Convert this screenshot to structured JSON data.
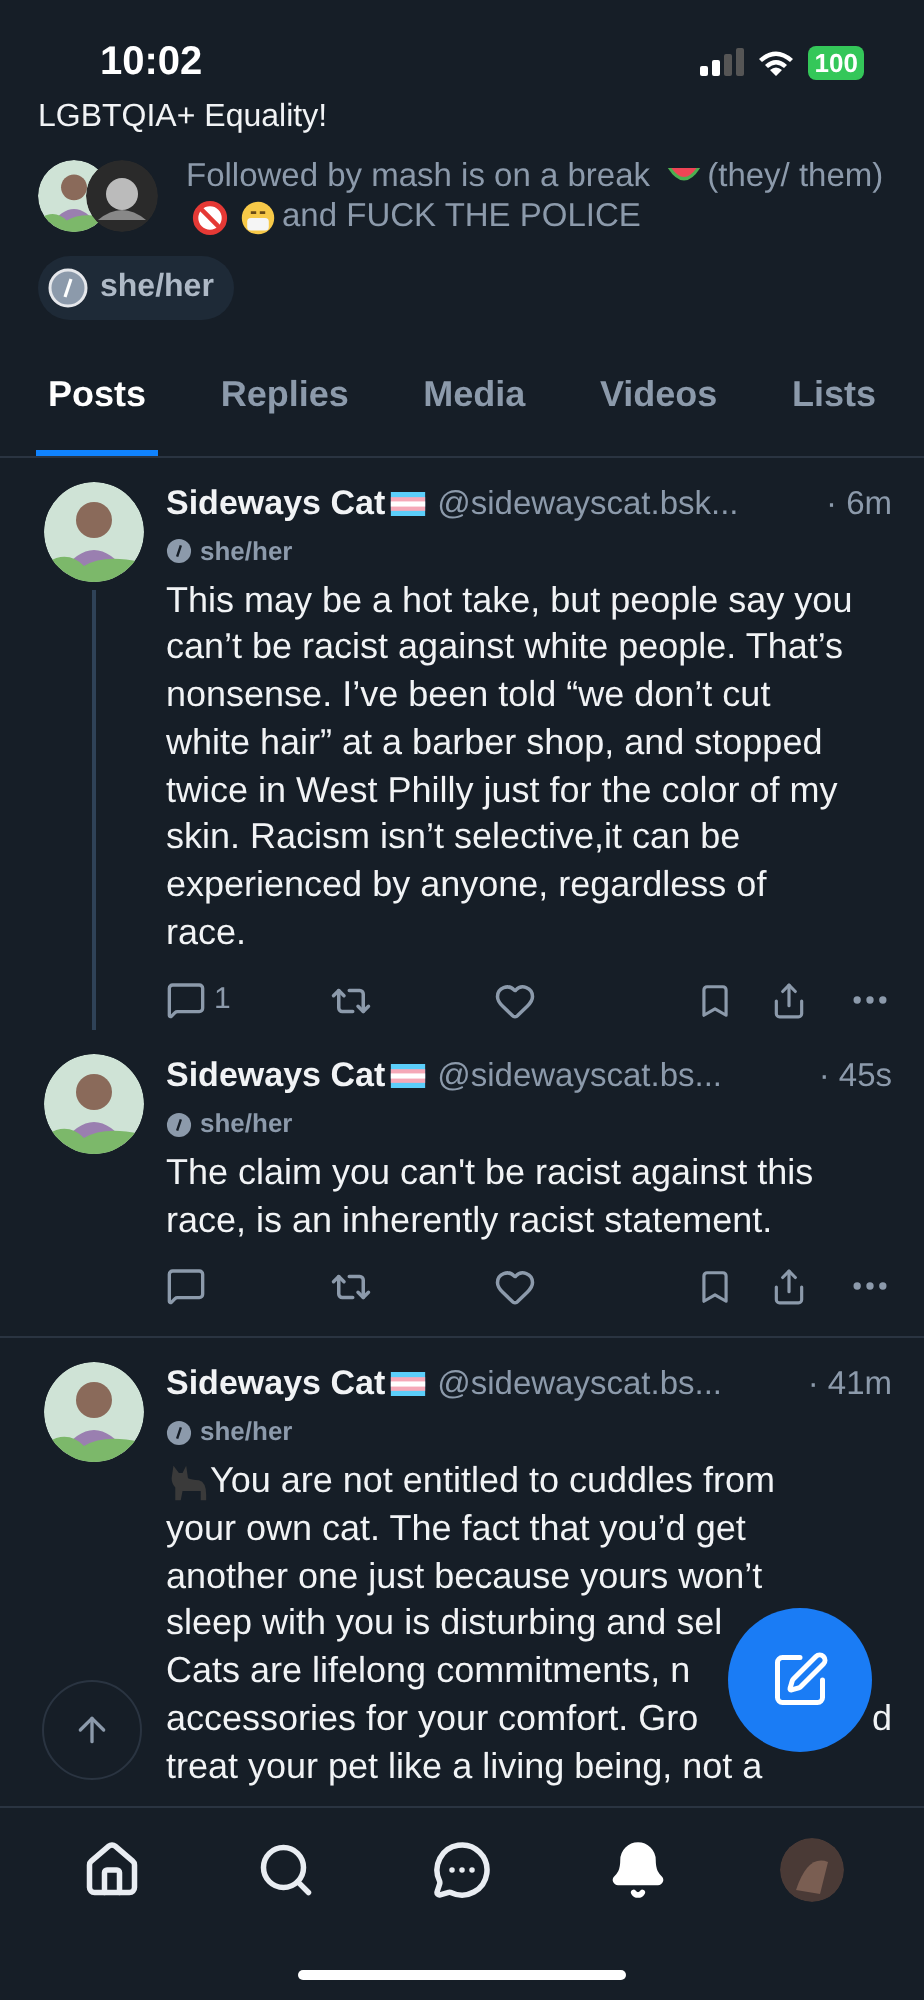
{
  "status_bar": {
    "time": "10:02",
    "battery": "100"
  },
  "profile": {
    "bio_tail": "LGBTQIA+ Equality!",
    "followed_by": [
      {
        "kind": "text",
        "text": "Followed by mash is on a break"
      },
      {
        "kind": "watermelon"
      },
      {
        "kind": "text",
        "text": "(they/ them)"
      },
      {
        "kind": "no-minors"
      },
      {
        "kind": "mask-face"
      },
      {
        "kind": "text",
        "text": "and FUCK THE POLICE"
      }
    ],
    "pronouns": "she/her"
  },
  "tabs": [
    {
      "label": "Posts",
      "selected": true
    },
    {
      "label": "Replies",
      "selected": false
    },
    {
      "label": "Media",
      "selected": false
    },
    {
      "label": "Videos",
      "selected": false
    },
    {
      "label": "Lists",
      "selected": false
    }
  ],
  "posts": [
    {
      "author": "Sideways Cat",
      "handle": "@sidewayscat.bsk...",
      "time": "· 6m",
      "pronouns": "she/her",
      "text": "This may be a hot take, but people say you can’t be racist against white people. That’s nonsense. I’ve been told “we don’t cut white hair” at a barber shop, and stopped twice in West Philly just for the color of my skin. Racism isn’t selective,it can be experienced by anyone, regardless of race.",
      "reply_count": "1",
      "thread_continues": true
    },
    {
      "author": "Sideways Cat",
      "handle": "@sidewayscat.bs...",
      "time": "· 45s",
      "pronouns": "she/her",
      "text": "The claim you can't be racist against this race, is an inherently racist statement.",
      "thread_continues": false
    },
    {
      "author": "Sideways Cat",
      "handle": "@sidewayscat.bs...",
      "time": "· 41m",
      "pronouns": "she/her",
      "lines": [
        {
          "kind": "cat-lead",
          "text": "You are not entitled to cuddles from"
        },
        {
          "kind": "plain",
          "text": "your own cat. The fact that you’d get"
        },
        {
          "kind": "plain",
          "text": "another one just because yours won’t"
        },
        {
          "kind": "plain",
          "text": "sleep with you is disturbing and sel"
        },
        {
          "kind": "plain",
          "text": "Cats are lifelong commitments, n"
        },
        {
          "kind": "plain",
          "text": "accessories for your comfort. Gro",
          "tail": "d"
        },
        {
          "kind": "plain",
          "text": "treat your pet like a living being, not a"
        }
      ],
      "thread_continues": false
    }
  ],
  "bottom_nav": [
    {
      "kind": "home",
      "selected": false
    },
    {
      "kind": "search",
      "selected": false
    },
    {
      "kind": "chat",
      "selected": false
    },
    {
      "kind": "bell",
      "selected": true
    },
    {
      "kind": "avatar",
      "selected": false
    }
  ]
}
